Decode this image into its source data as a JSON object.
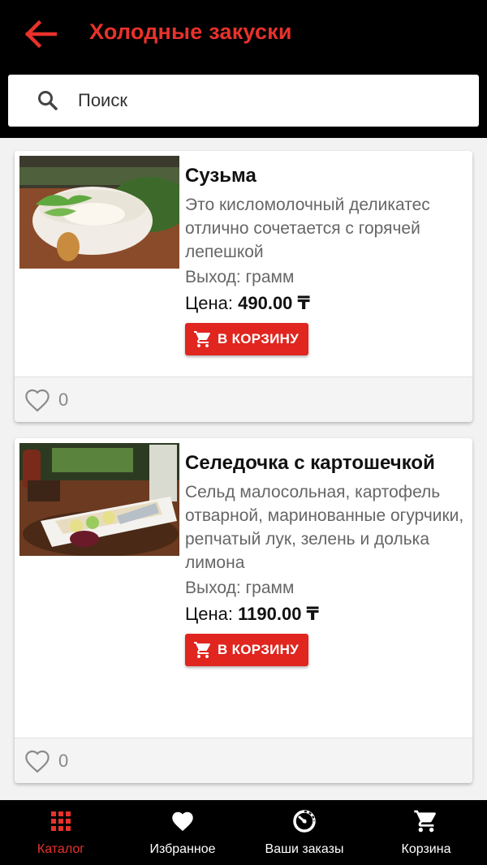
{
  "header": {
    "title": "Холодные закуски",
    "back_icon": "arrow-left-icon"
  },
  "search": {
    "placeholder": "Поиск",
    "icon": "search-icon"
  },
  "products": [
    {
      "name": "Сузьма",
      "description": "Это кисломолочный деликатес отлично сочетается с горячей лепешкой",
      "weight_label": "Выход: грамм",
      "price_label": "Цена: ",
      "price_value": "490.00 ₸",
      "cart_label": "В КОРЗИНУ",
      "likes": "0"
    },
    {
      "name": "Селедочка с картошечкой",
      "description": "Сельд малосольная, картофель отварной, маринованные огурчики, репчатый лук, зелень и долька лимона",
      "weight_label": "Выход: грамм",
      "price_label": "Цена: ",
      "price_value": "1190.00 ₸",
      "cart_label": "В КОРЗИНУ",
      "likes": "0"
    }
  ],
  "bottom_nav": {
    "items": [
      {
        "label": "Каталог",
        "icon": "grid-icon",
        "active": true
      },
      {
        "label": "Избранное",
        "icon": "heart-icon",
        "active": false
      },
      {
        "label": "Ваши заказы",
        "icon": "orders-timer-icon",
        "active": false
      },
      {
        "label": "Корзина",
        "icon": "cart-icon",
        "active": false
      }
    ]
  },
  "colors": {
    "accent": "#e8322b",
    "button": "#e0261f",
    "bar_bg": "#000000"
  }
}
